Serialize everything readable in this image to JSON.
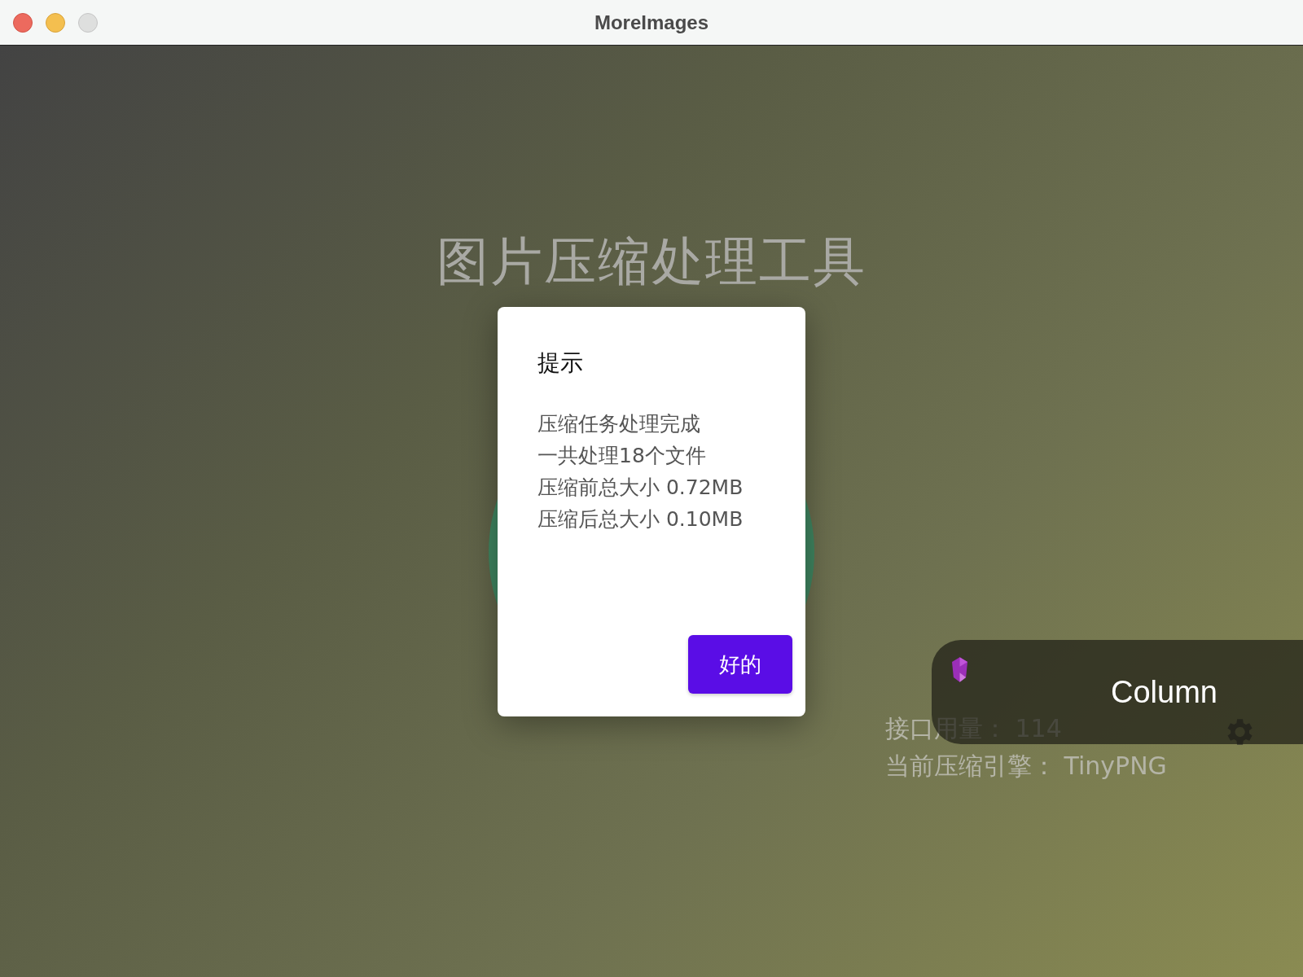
{
  "window": {
    "title": "MoreImages"
  },
  "app": {
    "heading": "图片压缩处理工具",
    "info_lines": [
      "接口用量： 114",
      "当前压缩引擎： TinyPNG"
    ]
  },
  "dialog": {
    "title": "提示",
    "lines": [
      "压缩任务处理完成",
      "一共处理18个文件",
      "压缩前总大小 0.72MB",
      "压缩后总大小 0.10MB"
    ],
    "buttons": [
      "好的"
    ]
  },
  "notification": {
    "label": "Column"
  }
}
